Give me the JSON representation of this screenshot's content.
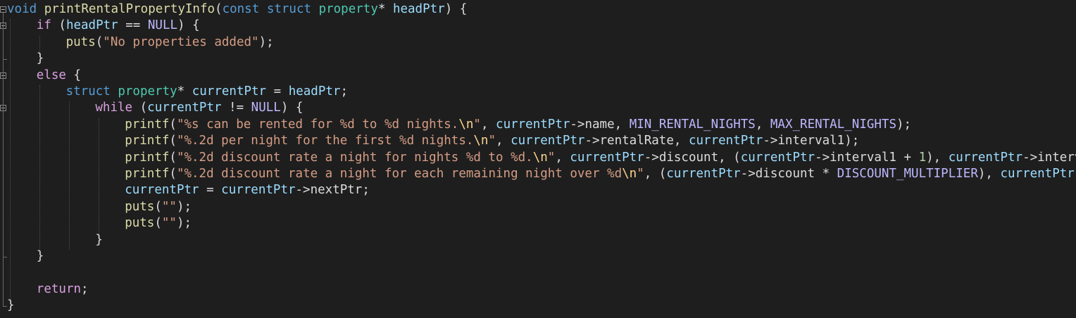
{
  "editor": {
    "colors": {
      "background": "#1e1e1e",
      "default": "#dcdcdc",
      "keyword": "#569cd6",
      "control": "#d8a0df",
      "function": "#dcdcaa",
      "type": "#4ec9b0",
      "variable": "#9cdcfe",
      "string": "#d69d85",
      "escape": "#ffd68f",
      "macro": "#beb7ff",
      "number": "#b5cea8"
    },
    "lines": [
      {
        "indent": 0,
        "tokens": [
          {
            "t": "void",
            "c": "kw"
          },
          {
            "t": " "
          },
          {
            "t": "printRentalPropertyInfo",
            "c": "fn"
          },
          {
            "t": "("
          },
          {
            "t": "const",
            "c": "kw"
          },
          {
            "t": " "
          },
          {
            "t": "struct",
            "c": "kw"
          },
          {
            "t": " "
          },
          {
            "t": "property",
            "c": "ty"
          },
          {
            "t": "* "
          },
          {
            "t": "headPtr",
            "c": "var"
          },
          {
            "t": ") {"
          }
        ]
      },
      {
        "indent": 1,
        "tokens": [
          {
            "t": "if",
            "c": "ctrl"
          },
          {
            "t": " ("
          },
          {
            "t": "headPtr",
            "c": "var"
          },
          {
            "t": " == "
          },
          {
            "t": "NULL",
            "c": "mac"
          },
          {
            "t": ") {"
          }
        ]
      },
      {
        "indent": 2,
        "tokens": [
          {
            "t": "puts",
            "c": "fn"
          },
          {
            "t": "("
          },
          {
            "t": "\"No properties added\"",
            "c": "str"
          },
          {
            "t": ");"
          }
        ]
      },
      {
        "indent": 1,
        "tokens": [
          {
            "t": "}"
          }
        ]
      },
      {
        "indent": 1,
        "tokens": [
          {
            "t": "else",
            "c": "ctrl"
          },
          {
            "t": " {"
          }
        ]
      },
      {
        "indent": 2,
        "tokens": [
          {
            "t": "struct",
            "c": "kw"
          },
          {
            "t": " "
          },
          {
            "t": "property",
            "c": "ty"
          },
          {
            "t": "* "
          },
          {
            "t": "currentPtr",
            "c": "var"
          },
          {
            "t": " = "
          },
          {
            "t": "headPtr",
            "c": "var"
          },
          {
            "t": ";"
          }
        ]
      },
      {
        "indent": 3,
        "tokens": [
          {
            "t": "while",
            "c": "ctrl"
          },
          {
            "t": " ("
          },
          {
            "t": "currentPtr",
            "c": "var"
          },
          {
            "t": " != "
          },
          {
            "t": "NULL",
            "c": "mac"
          },
          {
            "t": ") {"
          }
        ]
      },
      {
        "indent": 4,
        "tokens": [
          {
            "t": "printf",
            "c": "fn"
          },
          {
            "t": "("
          },
          {
            "t": "\"%s can be rented for %d to %d nights.",
            "c": "str"
          },
          {
            "t": "\\n",
            "c": "esc"
          },
          {
            "t": "\"",
            "c": "str"
          },
          {
            "t": ", "
          },
          {
            "t": "currentPtr",
            "c": "var"
          },
          {
            "t": "->name, "
          },
          {
            "t": "MIN_RENTAL_NIGHTS",
            "c": "mac"
          },
          {
            "t": ", "
          },
          {
            "t": "MAX_RENTAL_NIGHTS",
            "c": "mac"
          },
          {
            "t": ");"
          }
        ]
      },
      {
        "indent": 4,
        "tokens": [
          {
            "t": "printf",
            "c": "fn"
          },
          {
            "t": "("
          },
          {
            "t": "\"%.2d per night for the first %d nights.",
            "c": "str"
          },
          {
            "t": "\\n",
            "c": "esc"
          },
          {
            "t": "\"",
            "c": "str"
          },
          {
            "t": ", "
          },
          {
            "t": "currentPtr",
            "c": "var"
          },
          {
            "t": "->rentalRate, "
          },
          {
            "t": "currentPtr",
            "c": "var"
          },
          {
            "t": "->interval1);"
          }
        ]
      },
      {
        "indent": 4,
        "tokens": [
          {
            "t": "printf",
            "c": "fn"
          },
          {
            "t": "("
          },
          {
            "t": "\"%.2d discount rate a night for nights %d to %d.",
            "c": "str"
          },
          {
            "t": "\\n",
            "c": "esc"
          },
          {
            "t": "\"",
            "c": "str"
          },
          {
            "t": ", "
          },
          {
            "t": "currentPtr",
            "c": "var"
          },
          {
            "t": "->discount, ("
          },
          {
            "t": "currentPtr",
            "c": "var"
          },
          {
            "t": "->interval1 + "
          },
          {
            "t": "1",
            "c": "num"
          },
          {
            "t": "), "
          },
          {
            "t": "currentPtr",
            "c": "var"
          },
          {
            "t": "->interv"
          }
        ]
      },
      {
        "indent": 4,
        "tokens": [
          {
            "t": "printf",
            "c": "fn"
          },
          {
            "t": "("
          },
          {
            "t": "\"%.2d discount rate a night for each remaining night over %d",
            "c": "str"
          },
          {
            "t": "\\n",
            "c": "esc"
          },
          {
            "t": "\"",
            "c": "str"
          },
          {
            "t": ", ("
          },
          {
            "t": "currentPtr",
            "c": "var"
          },
          {
            "t": "->discount * "
          },
          {
            "t": "DISCOUNT_MULTIPLIER",
            "c": "mac"
          },
          {
            "t": "), "
          },
          {
            "t": "currentPtr",
            "c": "var"
          },
          {
            "t": "-"
          }
        ]
      },
      {
        "indent": 4,
        "tokens": [
          {
            "t": "currentPtr",
            "c": "var"
          },
          {
            "t": " = "
          },
          {
            "t": "currentPtr",
            "c": "var"
          },
          {
            "t": "->nextPtr;"
          }
        ]
      },
      {
        "indent": 4,
        "tokens": [
          {
            "t": "puts",
            "c": "fn"
          },
          {
            "t": "("
          },
          {
            "t": "\"\"",
            "c": "str"
          },
          {
            "t": ");"
          }
        ]
      },
      {
        "indent": 4,
        "tokens": [
          {
            "t": "puts",
            "c": "fn"
          },
          {
            "t": "("
          },
          {
            "t": "\"\"",
            "c": "str"
          },
          {
            "t": ");"
          }
        ]
      },
      {
        "indent": 3,
        "tokens": [
          {
            "t": "}"
          }
        ]
      },
      {
        "indent": 1,
        "tokens": [
          {
            "t": "}"
          }
        ]
      },
      {
        "indent": 0,
        "tokens": []
      },
      {
        "indent": 1,
        "tokens": [
          {
            "t": "return",
            "c": "ctrl"
          },
          {
            "t": ";"
          }
        ]
      },
      {
        "indent": 0,
        "tokens": [
          {
            "t": "}"
          }
        ]
      }
    ]
  }
}
